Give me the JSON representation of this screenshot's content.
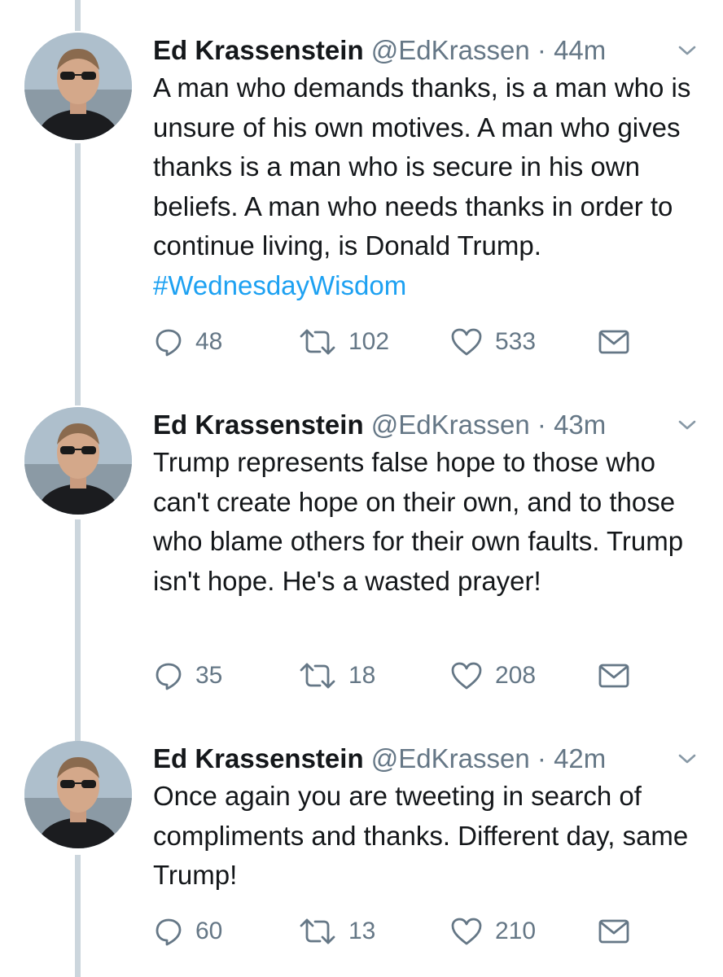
{
  "tweets": [
    {
      "author_name": "Ed Krassenstein",
      "handle": "@EdKrassen",
      "separator": "·",
      "time": "44m",
      "text": "A man who demands thanks, is a man who is unsure of his own motives. A man who gives thanks is a man who is secure in his own beliefs. A man who needs thanks in order to continue living, is Donald Trump.",
      "hashtag": "#WednesdayWisdom",
      "replies": "48",
      "retweets": "102",
      "likes": "533"
    },
    {
      "author_name": "Ed Krassenstein",
      "handle": "@EdKrassen",
      "separator": "·",
      "time": "43m",
      "text": "Trump represents false hope to those who can't create hope on their own, and to those who blame others for their own faults. Trump isn't hope.  He's a wasted prayer!",
      "hashtag": "",
      "replies": "35",
      "retweets": "18",
      "likes": "208"
    },
    {
      "author_name": "Ed Krassenstein",
      "handle": "@EdKrassen",
      "separator": "·",
      "time": "42m",
      "text": "Once again you are tweeting in search of compliments and thanks.  Different day, same Trump!",
      "hashtag": "",
      "replies": "60",
      "retweets": "13",
      "likes": "210"
    }
  ],
  "colors": {
    "text": "#14171a",
    "muted": "#657786",
    "hashtag": "#1da1f2",
    "thread_line": "#ccd6dd"
  },
  "icons": [
    "chevron-down-icon",
    "reply-icon",
    "retweet-icon",
    "like-icon",
    "message-icon"
  ]
}
